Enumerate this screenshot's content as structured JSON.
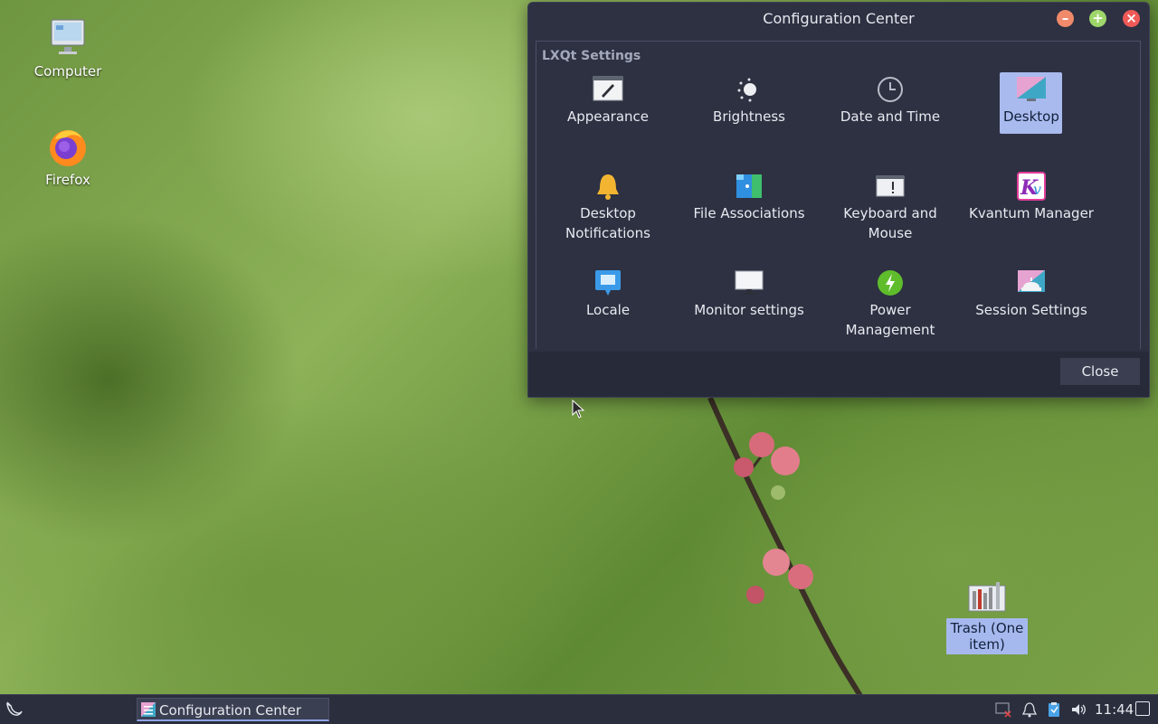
{
  "desktop": {
    "icons": [
      {
        "label": "Computer",
        "icon": "computer-icon"
      },
      {
        "label": "Firefox",
        "icon": "firefox-icon"
      },
      {
        "label": "Trash (One item)",
        "icon": "trash-icon"
      }
    ]
  },
  "window": {
    "title": "Configuration Center",
    "group_title": "LXQt Settings",
    "items": [
      {
        "label": "Appearance",
        "icon": "appearance-icon"
      },
      {
        "label": "Brightness",
        "icon": "brightness-icon"
      },
      {
        "label": "Date and Time",
        "icon": "clock-icon"
      },
      {
        "label": "Desktop",
        "icon": "desktop-icon",
        "selected": true
      },
      {
        "label": "Desktop Notifications",
        "icon": "bell-icon"
      },
      {
        "label": "File Associations",
        "icon": "file-associations-icon"
      },
      {
        "label": "Keyboard and Mouse",
        "icon": "keyboard-icon"
      },
      {
        "label": "Kvantum Manager",
        "icon": "kvantum-icon"
      },
      {
        "label": "Locale",
        "icon": "locale-icon"
      },
      {
        "label": "Monitor settings",
        "icon": "monitor-icon"
      },
      {
        "label": "Power Management",
        "icon": "power-icon"
      },
      {
        "label": "Session Settings",
        "icon": "session-icon"
      }
    ],
    "close_label": "Close"
  },
  "taskbar": {
    "task_label": "Configuration Center",
    "clock": "11:44"
  },
  "colors": {
    "window_bg": "#2d3142",
    "selection": "#a9baee",
    "accent": "#8fa4e6"
  }
}
